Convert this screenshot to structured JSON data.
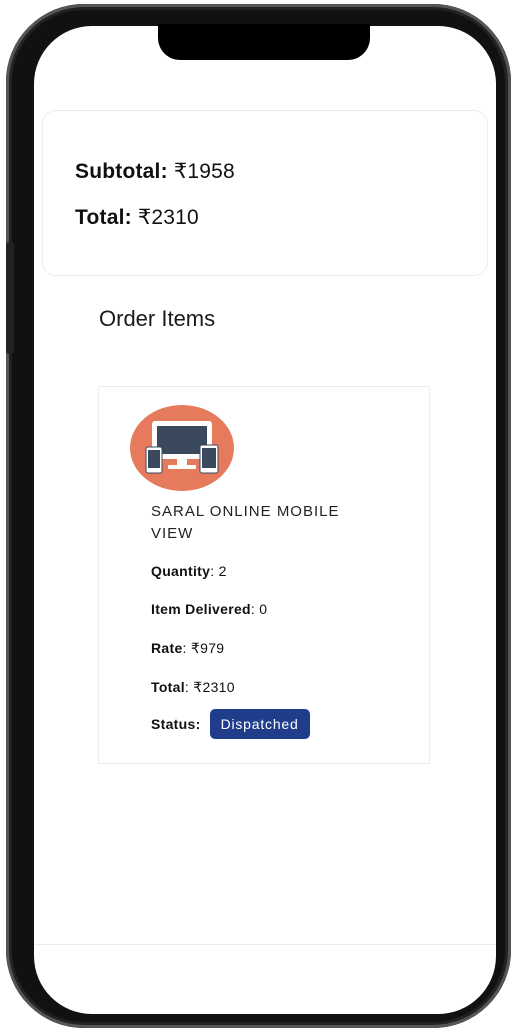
{
  "summary": {
    "subtotal_label": "Subtotal:",
    "subtotal_value": "₹1958",
    "total_label": "Total:",
    "total_value": "₹2310"
  },
  "order_items": {
    "title": "Order Items",
    "items": [
      {
        "icon": "devices-icon",
        "name": "SARAL ONLINE MOBILE VIEW",
        "quantity_label": "Quantity",
        "quantity_value": ": 2",
        "delivered_label": "Item Delivered",
        "delivered_value": ": 0",
        "rate_label": "Rate",
        "rate_value": ": ₹979",
        "total_label": "Total",
        "total_value": ": ₹2310",
        "status_label": "Status:",
        "status_value": "Dispatched"
      }
    ]
  },
  "colors": {
    "accent": "#1f3d8a",
    "icon_bg": "#e67a5c"
  }
}
